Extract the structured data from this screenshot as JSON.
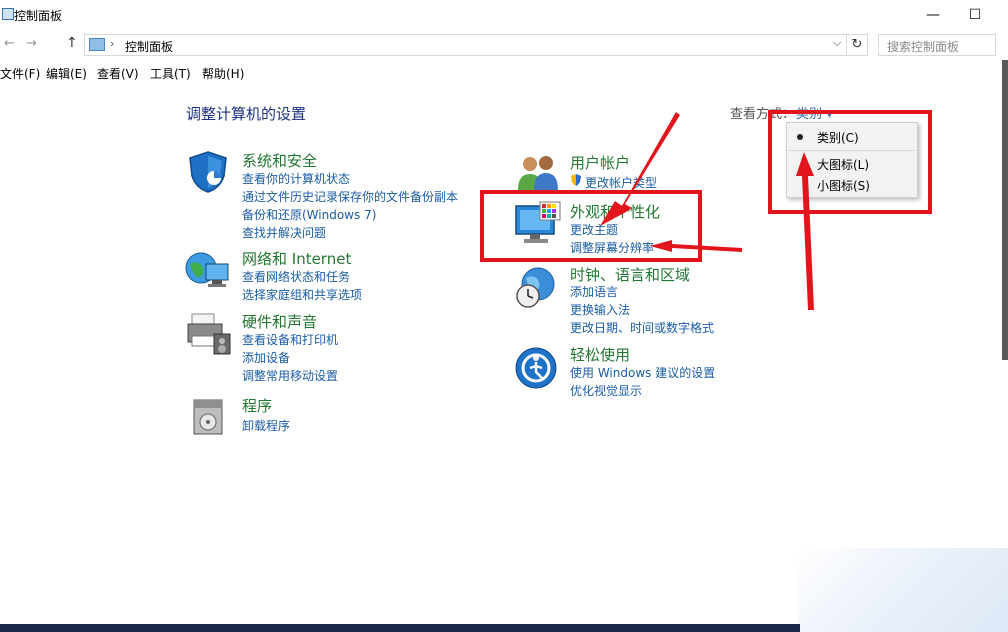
{
  "window": {
    "title": "控制面板",
    "minimize": "—",
    "maximize": "☐"
  },
  "nav": {
    "back": "←",
    "forward": "→",
    "up": "↑"
  },
  "address": {
    "separator": "›",
    "crumb": "控制面板",
    "dropdown": "⌵",
    "refresh": "↻"
  },
  "search": {
    "placeholder": "搜索控制面板"
  },
  "menubar": [
    "文件(F)",
    "编辑(E)",
    "查看(V)",
    "工具(T)",
    "帮助(H)"
  ],
  "main": {
    "heading": "调整计算机的设置",
    "view_by_label": "查看方式：",
    "view_by_value": "类别 ▾"
  },
  "categories_left": [
    {
      "title": "系统和安全",
      "links": [
        "查看你的计算机状态",
        "通过文件历史记录保存你的文件备份副本",
        "备份和还原(Windows 7)",
        "查找并解决问题"
      ]
    },
    {
      "title": "网络和 Internet",
      "links": [
        "查看网络状态和任务",
        "选择家庭组和共享选项"
      ]
    },
    {
      "title": "硬件和声音",
      "links": [
        "查看设备和打印机",
        "添加设备",
        "调整常用移动设置"
      ]
    },
    {
      "title": "程序",
      "links": [
        "卸载程序"
      ]
    }
  ],
  "categories_right": [
    {
      "title": "用户帐户",
      "links": [
        "更改帐户类型"
      ]
    },
    {
      "title": "外观和个性化",
      "links": [
        "更改主题",
        "调整屏幕分辨率"
      ]
    },
    {
      "title": "时钟、语言和区域",
      "links": [
        "添加语言",
        "更换输入法",
        "更改日期、时间或数字格式"
      ]
    },
    {
      "title": "轻松使用",
      "links": [
        "使用 Windows 建议的设置",
        "优化视觉显示"
      ]
    }
  ],
  "view_menu": {
    "items": [
      "类别(C)",
      "大图标(L)",
      "小图标(S)"
    ],
    "selected": "类别(C)"
  },
  "colors": {
    "annotation_red": "#e2151d",
    "category_green": "#247733",
    "link_blue": "#1b5ca8",
    "heading_blue": "#1e3287"
  }
}
